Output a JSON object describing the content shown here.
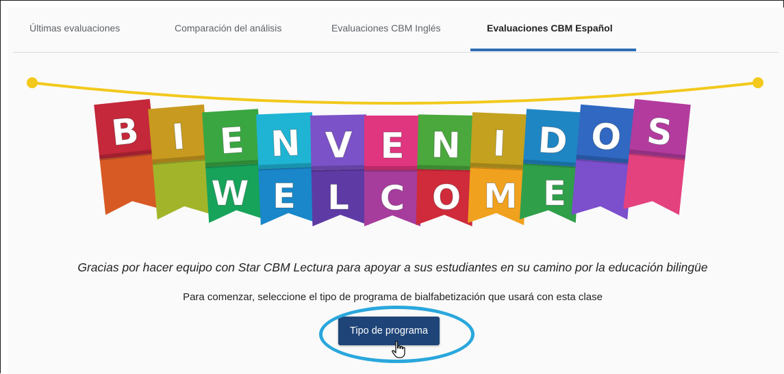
{
  "tabs": [
    {
      "label": "Últimas evaluaciones"
    },
    {
      "label": "Comparación del análisis"
    },
    {
      "label": "Evaluaciones CBM Inglés"
    },
    {
      "label": "Evaluaciones CBM Español",
      "active": true
    }
  ],
  "banner": {
    "top_word": [
      "B",
      "I",
      "E",
      "N",
      "V",
      "E",
      "N",
      "I",
      "D",
      "O",
      "S"
    ],
    "bottom_word": [
      "W",
      "E",
      "L",
      "C",
      "O",
      "M",
      "E"
    ],
    "flag_colors": [
      "#c4283a",
      "#c89a1f",
      "#3aa642",
      "#1fb4d4",
      "#7b52c7",
      "#e0357f",
      "#4aa83c",
      "#c4a21f",
      "#1f86c4",
      "#3068c2",
      "#b33b9e"
    ],
    "string_color": "#f2c91c"
  },
  "message": {
    "tagline": "Gracias por hacer equipo con Star CBM Lectura para apoyar a sus estudiantes en su camino por la educación bilingüe",
    "instruction": "Para comenzar, seleccione el tipo de programa de bialfabetización que usará con esta clase"
  },
  "program_button": {
    "label": "Tipo de programa"
  },
  "colors": {
    "accent": "#2f6db5",
    "button": "#1f4578",
    "highlight": "#29a7dc"
  }
}
